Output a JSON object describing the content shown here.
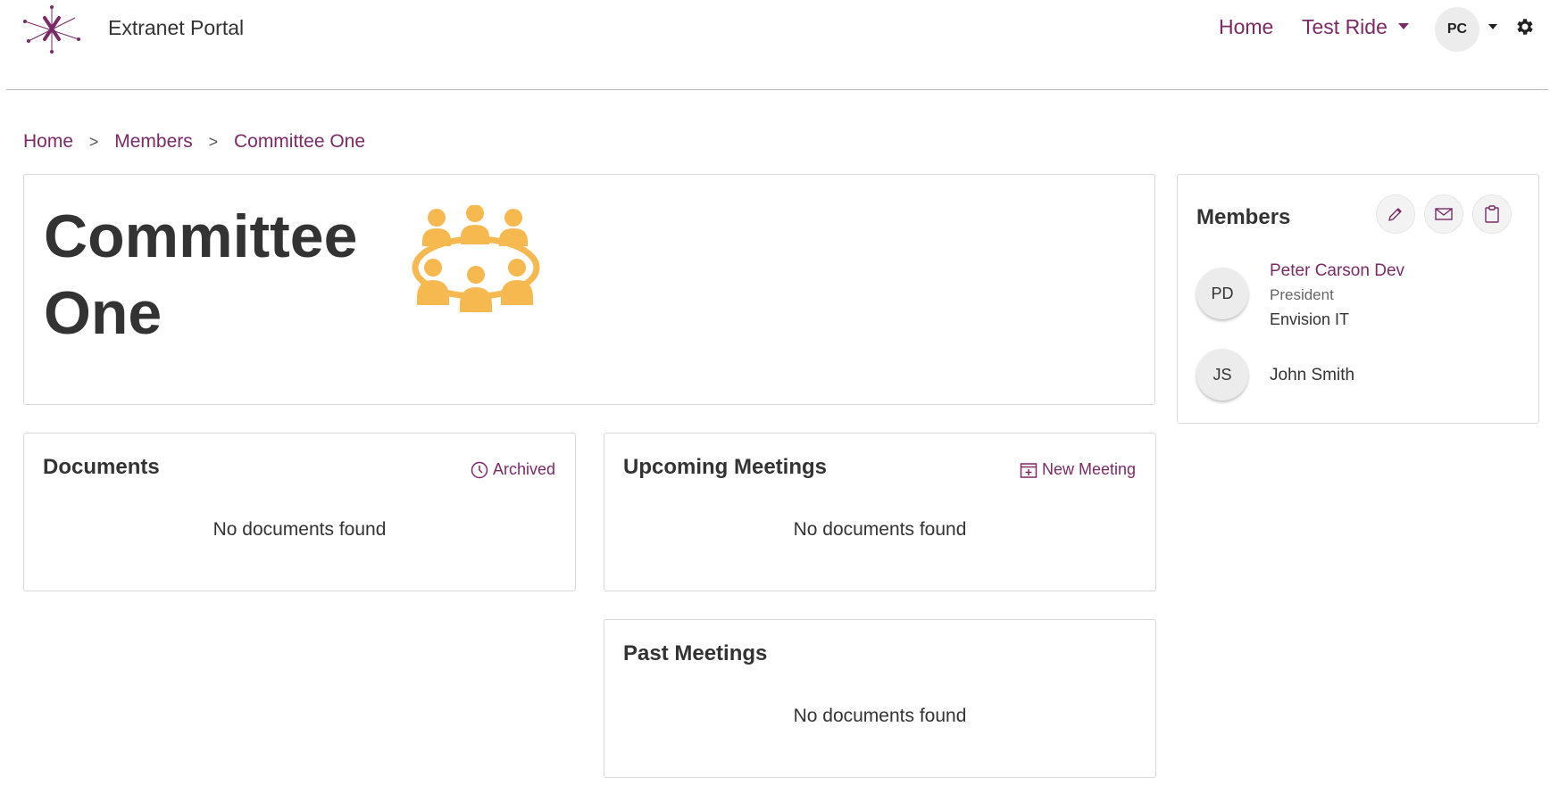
{
  "header": {
    "app_name": "Extranet Portal",
    "nav": [
      {
        "label": "Home"
      },
      {
        "label": "Test Ride"
      }
    ],
    "user_initials": "PC",
    "icons": {
      "logo": "asterisk-logo-icon",
      "gear": "gear-icon",
      "caret": "caret-down-icon"
    }
  },
  "breadcrumb": [
    "Home",
    "Members",
    "Committee One"
  ],
  "breadcrumb_separator": ">",
  "page": {
    "title": "Committee One",
    "title_icon": "meeting-table-icon"
  },
  "documents": {
    "title": "Documents",
    "action_label": "Archived",
    "action_icon": "clock-icon",
    "empty_text": "No documents found"
  },
  "upcoming_meetings": {
    "title": "Upcoming Meetings",
    "action_label": "New Meeting",
    "action_icon": "calendar-plus-icon",
    "empty_text": "No documents found"
  },
  "past_meetings": {
    "title": "Past Meetings",
    "empty_text": "No documents found"
  },
  "members": {
    "title": "Members",
    "actions": [
      "pencil-icon",
      "envelope-icon",
      "clipboard-icon"
    ],
    "list": [
      {
        "initials": "PD",
        "name": "Peter Carson Dev",
        "role": "President",
        "org": "Envision IT"
      },
      {
        "initials": "JS",
        "name": "John Smith"
      }
    ]
  },
  "colors": {
    "accent": "#7b2a66",
    "icon_yellow": "#f5b94f",
    "text": "#333333",
    "border": "#d9d9d9"
  }
}
